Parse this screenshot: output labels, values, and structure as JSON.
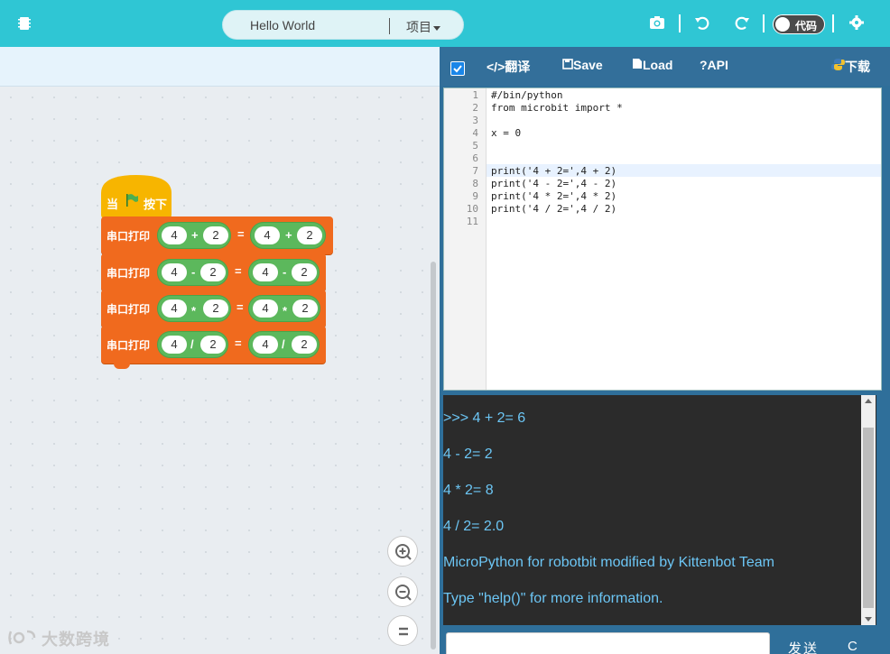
{
  "topbar": {
    "project_name": "Hello World",
    "project_menu": "项目",
    "code_toggle_label": "代码"
  },
  "workspace": {
    "hat": {
      "prefix": "当",
      "suffix": "按下"
    },
    "blocks": [
      {
        "label": "串口打印",
        "left_a": "4",
        "left_op": "+",
        "left_b": "2",
        "eq": "=",
        "right_a": "4",
        "right_op": "+",
        "right_b": "2"
      },
      {
        "label": "串口打印",
        "left_a": "4",
        "left_op": "-",
        "left_b": "2",
        "eq": "=",
        "right_a": "4",
        "right_op": "-",
        "right_b": "2"
      },
      {
        "label": "串口打印",
        "left_a": "4",
        "left_op": "*",
        "left_b": "2",
        "eq": "=",
        "right_a": "4",
        "right_op": "*",
        "right_b": "2"
      },
      {
        "label": "串口打印",
        "left_a": "4",
        "left_op": "/",
        "left_b": "2",
        "eq": "=",
        "right_a": "4",
        "right_op": "/",
        "right_b": "2"
      }
    ],
    "watermark": "大数跨境"
  },
  "editor": {
    "toolbar": {
      "translate": "</>翻译",
      "save": "Save",
      "load": "Load",
      "api": "?API",
      "download": "下载"
    },
    "line_numbers": [
      "1",
      "2",
      "3",
      "4",
      "5",
      "6",
      "7",
      "8",
      "9",
      "10",
      "11"
    ],
    "lines": [
      "#/bin/python",
      "from microbit import *",
      "",
      "x = 0",
      "",
      "",
      "print('4 + 2=',4 + 2)",
      "print('4 - 2=',4 - 2)",
      "print('4 * 2=',4 * 2)",
      "print('4 / 2=',4 / 2)",
      ""
    ]
  },
  "terminal": {
    "lines": [
      ">>> 4 + 2= 6",
      "4 - 2= 2",
      "4 * 2= 8",
      "4 / 2= 2.0",
      "MicroPython for robotbit modified by Kittenbot Team",
      "Type \"help()\" for more information."
    ],
    "send_label": "发送",
    "clear_label": "C"
  },
  "colors": {
    "topbar": "#2fc6d4",
    "block": "#f06a1e",
    "operator": "#5cb85c",
    "hat": "#f7b500",
    "terminal_text": "#6cc6f5"
  }
}
